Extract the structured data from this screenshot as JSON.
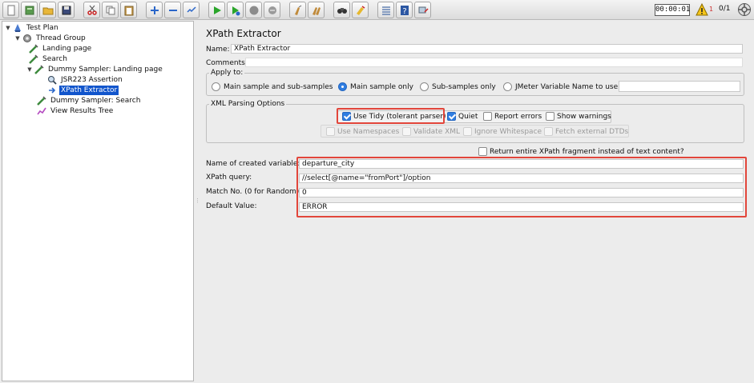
{
  "toolbar": {
    "icons": [
      "new-icon",
      "templates-icon",
      "open-icon",
      "save-icon",
      "cut-icon",
      "copy-icon",
      "paste-icon",
      "expand-icon",
      "collapse-icon",
      "toggle-icon",
      "start-icon",
      "start-no-pause-icon",
      "stop-icon",
      "shutdown-icon",
      "clear-icon",
      "clear-all-icon",
      "search-icon",
      "reset-search-icon",
      "function-helper-icon",
      "help-icon",
      "remote-icon"
    ],
    "timer": "00:00:01",
    "warning_count": "1",
    "threads": "0/1"
  },
  "tree": {
    "nodes": [
      {
        "label": "Test Plan",
        "icon": "test-plan-icon"
      },
      {
        "label": "Thread Group",
        "icon": "thread-group-icon"
      },
      {
        "label": "Landing page",
        "icon": "sampler-icon"
      },
      {
        "label": "Search",
        "icon": "sampler-icon"
      },
      {
        "label": "Dummy Sampler: Landing page",
        "icon": "sampler-icon"
      },
      {
        "label": "JSR223 Assertion",
        "icon": "assertion-icon"
      },
      {
        "label": "XPath Extractor",
        "icon": "extractor-icon"
      },
      {
        "label": "Dummy Sampler: Search",
        "icon": "sampler-icon"
      },
      {
        "label": "View Results Tree",
        "icon": "listener-icon"
      }
    ]
  },
  "panel": {
    "title": "XPath Extractor",
    "name_label": "Name:",
    "name_value": "XPath Extractor",
    "comments_label": "Comments:",
    "comments_value": "",
    "apply_to": {
      "title": "Apply to:",
      "options": [
        "Main sample and sub-samples",
        "Main sample only",
        "Sub-samples only",
        "JMeter Variable Name to use"
      ],
      "selected": "Main sample only",
      "variable_value": ""
    },
    "xml_parsing": {
      "title": "XML Parsing Options",
      "use_tidy": "Use Tidy (tolerant parser)",
      "quiet": "Quiet",
      "report_errors": "Report errors",
      "show_warnings": "Show warnings",
      "use_namespaces": "Use Namespaces",
      "validate_xml": "Validate XML",
      "ignore_whitespace": "Ignore Whitespace",
      "fetch_dtds": "Fetch external DTDs"
    },
    "return_fragment": "Return entire XPath fragment instead of text content?",
    "fields": {
      "var_label": "Name of created variable:",
      "var_value": "departure_city",
      "query_label": "XPath query:",
      "query_value": "//select[@name=\"fromPort\"]/option",
      "match_label": "Match No. (0 for Random):",
      "match_value": "0",
      "default_label": "Default Value:",
      "default_value": "ERROR"
    }
  },
  "colors": {
    "highlight": "#e2463b",
    "selection": "#1155cc",
    "checkbox_on": "#2f7de1"
  }
}
